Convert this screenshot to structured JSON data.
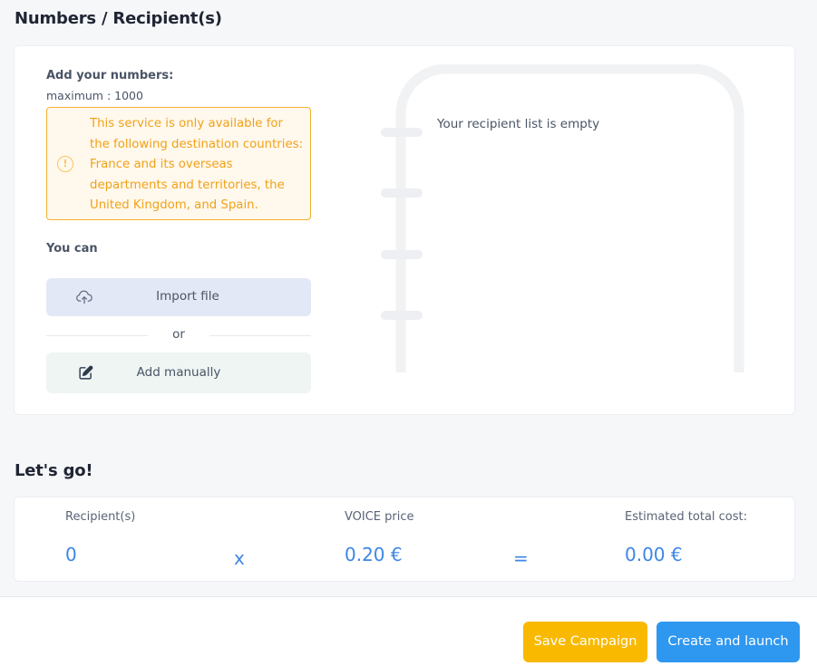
{
  "section_numbers": {
    "title": "Numbers / Recipient(s)",
    "add_label": "Add your numbers:",
    "max_label": "maximum : 1000",
    "warning": {
      "icon": "exclamation-circle-icon",
      "text": "This service is only available for the following destination countries: France and its overseas departments and territories, the United Kingdom, and Spain."
    },
    "you_can_label": "You can",
    "import_button": {
      "icon": "cloud-upload-icon",
      "label": "Import file"
    },
    "or_label": "or",
    "manual_button": {
      "icon": "edit-icon",
      "label": "Add manually"
    },
    "recipient_list": {
      "empty_text": "Your recipient list is empty"
    }
  },
  "section_go": {
    "title": "Let's go!",
    "recipients": {
      "label": "Recipient(s)",
      "value": "0"
    },
    "times_op": "x",
    "price": {
      "label": "VOICE price",
      "value": "0.20 €"
    },
    "equals_op": "=",
    "total": {
      "label": "Estimated total cost:",
      "value": "0.00 €"
    }
  },
  "footer": {
    "save_label": "Save Campaign",
    "launch_label": "Create and launch"
  },
  "colors": {
    "accent_blue": "#2e97f0",
    "save_yellow": "#f9b900",
    "warning_orange": "#f0a21a",
    "value_blue": "#3d86e6"
  }
}
